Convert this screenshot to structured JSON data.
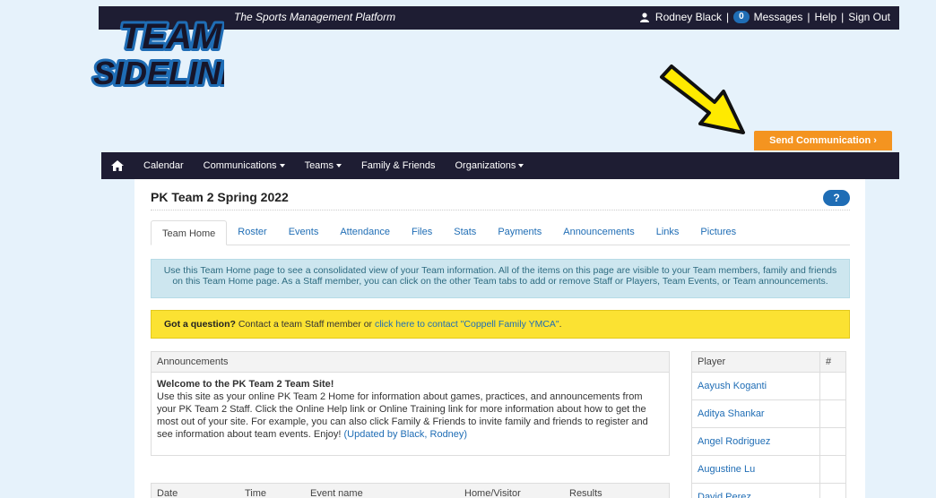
{
  "header": {
    "tagline": "The Sports Management Platform",
    "user_name": "Rodney Black",
    "messages_count": "0",
    "messages_label": "Messages",
    "help_label": "Help",
    "signout_label": "Sign Out"
  },
  "logo": {
    "line1": "TEAM",
    "line2": "SIDELINE"
  },
  "send_communication_label": "Send Communication ›",
  "nav": {
    "items": [
      "Calendar",
      "Communications",
      "Teams",
      "Family & Friends",
      "Organizations"
    ]
  },
  "page": {
    "title": "PK Team 2 Spring 2022",
    "help_label": "?"
  },
  "tabs": [
    "Team Home",
    "Roster",
    "Events",
    "Attendance",
    "Files",
    "Stats",
    "Payments",
    "Announcements",
    "Links",
    "Pictures"
  ],
  "info_text": "Use this Team Home page to see a consolidated view of your Team information. All of the items on this page are visible to your Team members, family and friends on this Team Home page. As a Staff member, you can click on the other Team tabs to add or remove Staff or Players, Team Events, or Team announcements.",
  "question": {
    "bold": "Got a question?",
    "text": " Contact a team Staff member or ",
    "link": "click here to contact \"Coppell Family YMCA\"",
    "end": "."
  },
  "announcements": {
    "header": "Announcements",
    "title": "Welcome to the PK Team 2 Team Site!",
    "body": "Use this site as your online PK Team 2 Home for information about games, practices, and announcements from your PK Team 2 Staff. Click the Online Help link or Online Training link for more information about how to get the most out of your site. For example, you can also click Family & Friends to invite family and friends to register and see information about team events. Enjoy!",
    "updated": "(Updated by Black, Rodney)"
  },
  "events_table": {
    "columns": [
      "Date",
      "Time",
      "Event name",
      "Home/Visitor",
      "Results"
    ]
  },
  "players": {
    "col_player": "Player",
    "col_num": "#",
    "rows": [
      "Aayush Koganti",
      "Aditya Shankar",
      "Angel Rodriguez",
      "Augustine Lu",
      "David Perez"
    ]
  },
  "colors": {
    "nav_bg": "#1e1d33",
    "accent_orange": "#f49420",
    "link_blue": "#1f6db5",
    "info_bg": "#cde6ef",
    "warn_bg": "#fbe232",
    "arrow_yellow": "#ffea00"
  }
}
